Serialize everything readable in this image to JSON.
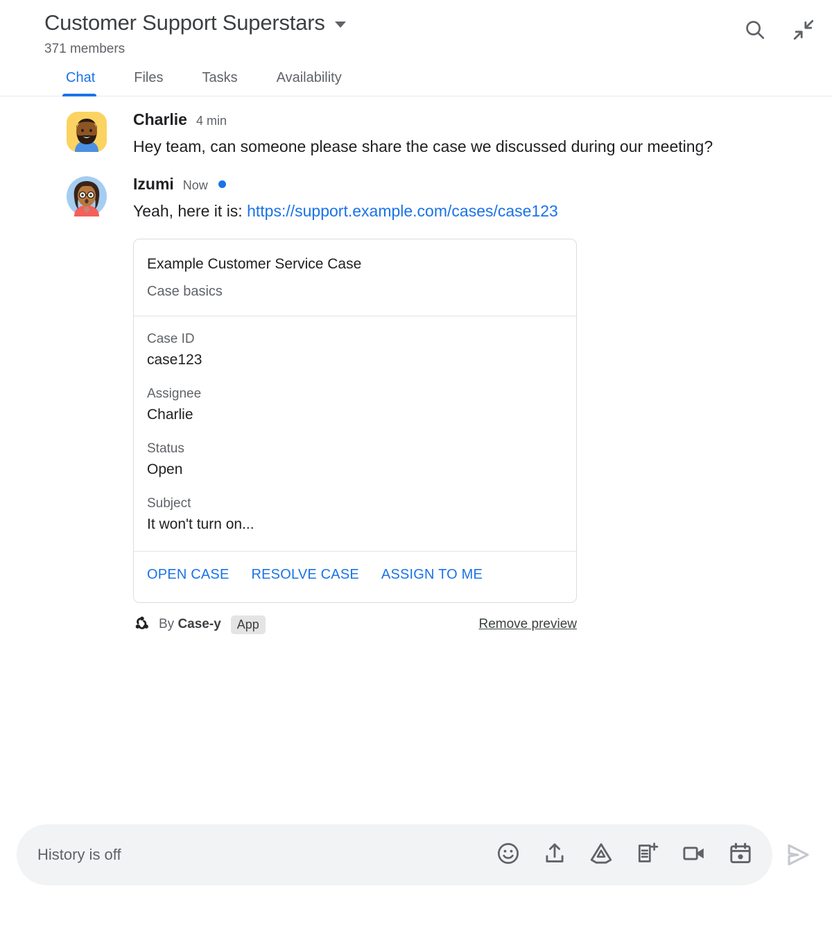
{
  "header": {
    "room_title": "Customer Support Superstars",
    "members": "371 members",
    "dropdown_icon": "chevron-down-icon",
    "search_icon": "search-icon",
    "collapse_icon": "collapse-icon"
  },
  "tabs": [
    {
      "label": "Chat",
      "active": true
    },
    {
      "label": "Files",
      "active": false
    },
    {
      "label": "Tasks",
      "active": false
    },
    {
      "label": "Availability",
      "active": false
    }
  ],
  "messages": [
    {
      "sender": "Charlie",
      "time": "4 min",
      "unread": false,
      "text": "Hey team, can someone please share the case we discussed during our meeting?"
    },
    {
      "sender": "Izumi",
      "time": "Now",
      "unread": true,
      "text_prefix": "Yeah, here it is: ",
      "link_text": "https://support.example.com/cases/case123"
    }
  ],
  "card": {
    "title": "Example Customer Service Case",
    "subtitle": "Case basics",
    "fields": [
      {
        "label": "Case ID",
        "value": "case123"
      },
      {
        "label": "Assignee",
        "value": "Charlie"
      },
      {
        "label": "Status",
        "value": "Open"
      },
      {
        "label": "Subject",
        "value": "It won't turn on..."
      }
    ],
    "actions": [
      {
        "label": "OPEN CASE"
      },
      {
        "label": "RESOLVE CASE"
      },
      {
        "label": "ASSIGN TO ME"
      }
    ]
  },
  "attribution": {
    "icon": "webhook-icon",
    "by_text": "By ",
    "app_name": "Case-y",
    "badge": "App",
    "remove_preview": "Remove preview"
  },
  "compose": {
    "placeholder": "History is off",
    "value": "",
    "icons": [
      "emoji-icon",
      "upload-icon",
      "google-drive-icon",
      "add-document-icon",
      "video-meeting-icon",
      "calendar-icon"
    ],
    "send_icon": "send-icon"
  },
  "colors": {
    "accent": "#1a73e8",
    "text_primary": "#202124",
    "text_secondary": "#5f6368",
    "border": "#dadce0",
    "compose_bg": "#f1f3f4",
    "badge_bg": "#e4e4e4",
    "send_disabled": "#c4c8cd"
  }
}
